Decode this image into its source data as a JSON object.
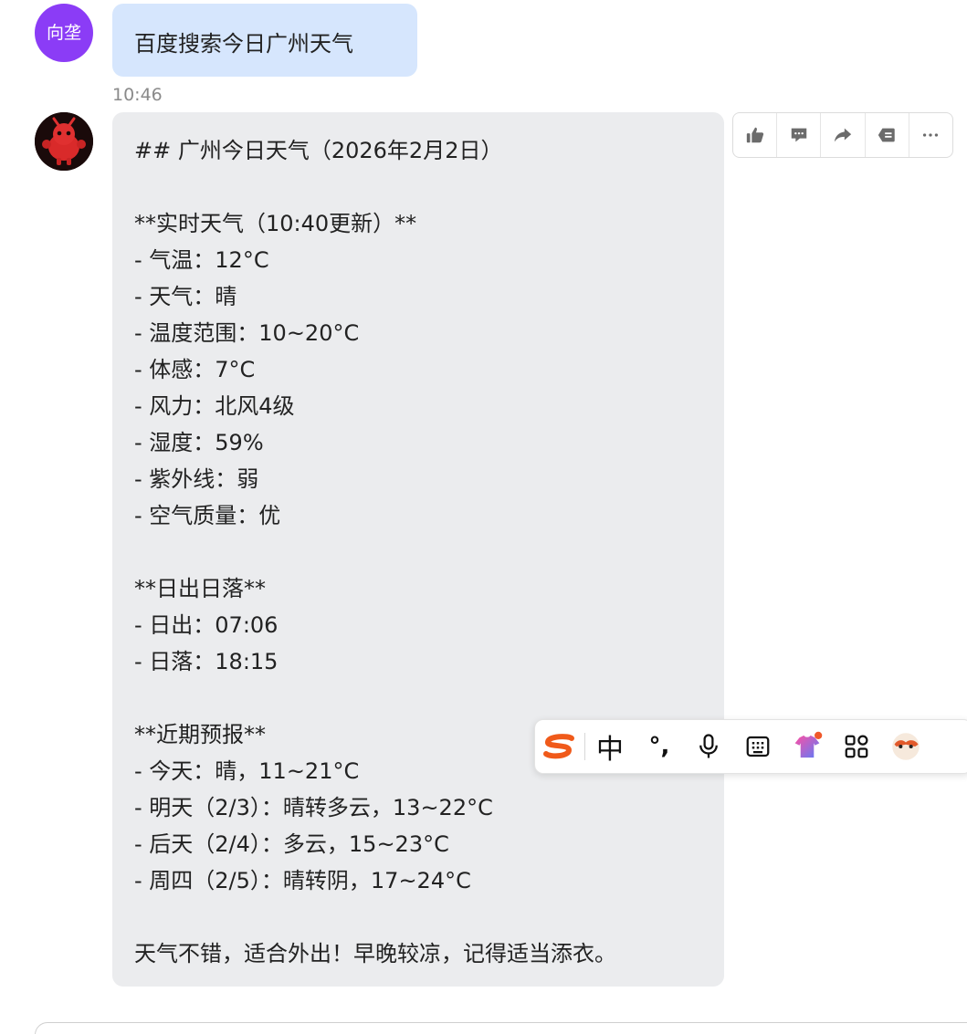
{
  "user_message": {
    "avatar_text": "向垄",
    "text": "百度搜索今日广州天气",
    "time": "10:46"
  },
  "bot_message": {
    "lines": [
      "## 广州今日天气（2026年2月2日）",
      "",
      "**实时天气（10:40更新）**",
      "- 气温：12°C",
      "- 天气：晴",
      "- 温度范围：10~20°C",
      "- 体感：7°C",
      "- 风力：北风4级",
      "- 湿度：59%",
      "- 紫外线：弱",
      "- 空气质量：优",
      "",
      "**日出日落**",
      "- 日出：07:06",
      "- 日落：18:15",
      "",
      "**近期预报**",
      "- 今天：晴，11~21°C",
      "- 明天（2/3）：晴转多云，13~22°C",
      "- 后天（2/4）：多云，15~23°C",
      "- 周四（2/5）：晴转阴，17~24°C",
      "",
      "天气不错，适合外出！早晚较凉，记得适当添衣。"
    ]
  },
  "message_actions": [
    {
      "icon": "thumbs-up-icon"
    },
    {
      "icon": "comment-icon"
    },
    {
      "icon": "forward-icon"
    },
    {
      "icon": "quote-icon"
    },
    {
      "icon": "more-icon"
    }
  ],
  "ime_toolbar": {
    "mode_label": "中",
    "punct_label": "°,",
    "items": [
      "sogou-logo-icon",
      "chinese-mode",
      "punctuation",
      "microphone-icon",
      "keyboard-icon",
      "skin-icon",
      "toolbox-icon",
      "mascot-icon"
    ]
  },
  "colors": {
    "user_bubble": "#d6e6fd",
    "bot_bubble": "#ebecee",
    "user_avatar": "#8b3cf6",
    "timestamp": "#8a8a8a",
    "sogou_orange": "#f05a1a"
  }
}
